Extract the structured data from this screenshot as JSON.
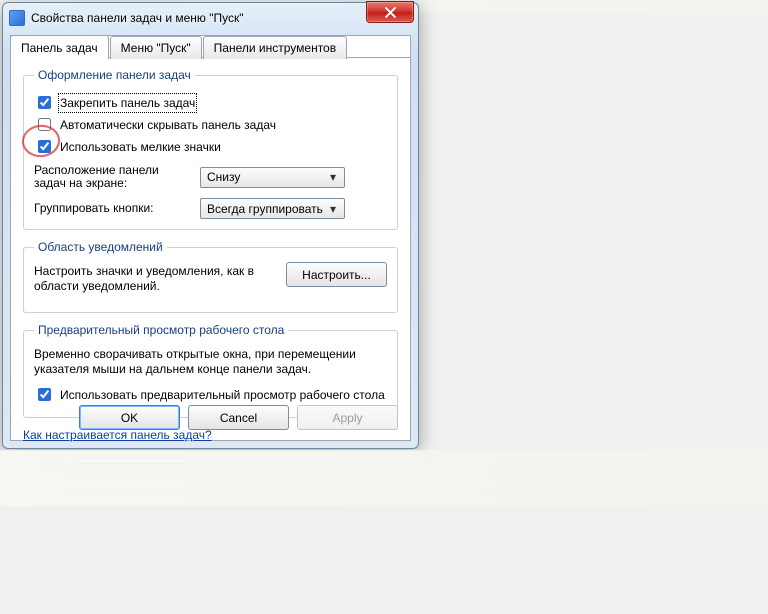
{
  "window": {
    "title": "Свойства панели задач и меню \"Пуск\""
  },
  "tabs": {
    "taskbar": "Панель задач",
    "startmenu": "Меню \"Пуск\"",
    "toolbars": "Панели инструментов"
  },
  "group1": {
    "legend": "Оформление панели задач",
    "lock": "Закрепить панель задач",
    "autohide": "Автоматически скрывать панель задач",
    "smallicons": "Использовать мелкие значки",
    "location_label": "Расположение панели задач на экране:",
    "location_value": "Снизу",
    "group_label": "Группировать кнопки:",
    "group_value": "Всегда группировать"
  },
  "group2": {
    "legend": "Область уведомлений",
    "desc": "Настроить значки и уведомления, как в области уведомлений.",
    "customize": "Настроить..."
  },
  "group3": {
    "legend": "Предварительный просмотр рабочего стола",
    "desc": "Временно сворачивать открытые окна, при перемещении указателя мыши на дальнем конце панели задач.",
    "peek": "Использовать предварительный просмотр рабочего стола"
  },
  "help_link": "Как настраивается панель задач?",
  "buttons": {
    "ok": "OK",
    "cancel": "Cancel",
    "apply": "Apply"
  },
  "checked": {
    "lock": true,
    "autohide": false,
    "smallicons": true,
    "peek": true
  }
}
